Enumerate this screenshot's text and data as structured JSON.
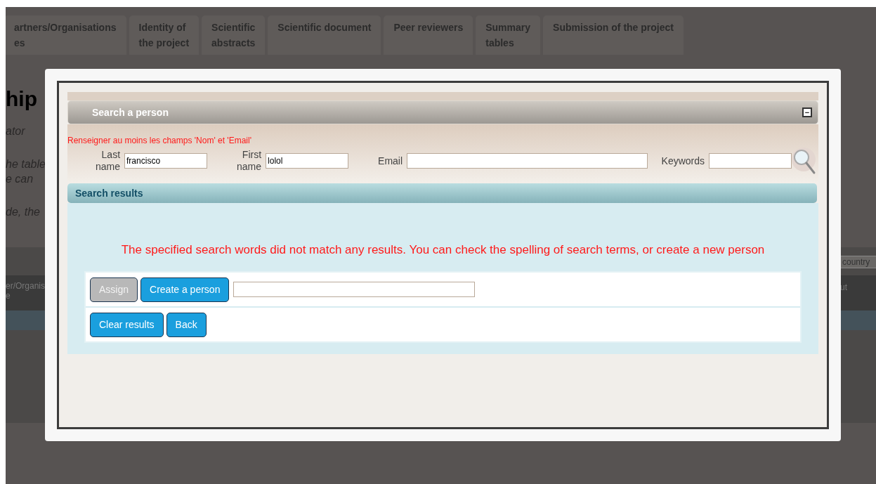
{
  "background": {
    "tabs": [
      {
        "label": "artners/Organisations\nes",
        "selected": false
      },
      {
        "label": "Identity of\nthe project",
        "selected": false
      },
      {
        "label": "Scientific\nabstracts",
        "selected": false
      },
      {
        "label": "Scientific document",
        "selected": false
      },
      {
        "label": "Peer reviewers",
        "selected": false
      },
      {
        "label": "Summary\ntables",
        "selected": false
      },
      {
        "label": "Submission of the project",
        "selected": false
      }
    ],
    "heading": "hip",
    "paragraphs": [
      "ator",
      "he table\ne can",
      "de, the"
    ],
    "table": {
      "filter_placeholder": "country",
      "column_1": "er/Organis\ne",
      "column_last": "ut"
    }
  },
  "dialog": {
    "panel_title": "Search a person",
    "collapse_icon": "−",
    "instruction": "Renseigner au moins les champs 'Nom' et 'Email'",
    "fields": [
      {
        "label": "Last\nname",
        "value": "francisco",
        "kind": "short"
      },
      {
        "label": "First\nname",
        "value": "lolol",
        "kind": "short"
      },
      {
        "label": "Email",
        "kind": "wide"
      },
      {
        "label": "Keywords",
        "kind": "short"
      }
    ],
    "results_title": "Search results",
    "message": "The specified search words did not match any results. You can check the spelling of search terms, or create a new person",
    "rows": [
      {
        "buttons": [
          {
            "label": "Assign",
            "disabled": true
          },
          {
            "label": "Create a person",
            "disabled": false
          }
        ],
        "has_field": true
      },
      {
        "buttons": [
          {
            "label": "Clear results",
            "disabled": false
          },
          {
            "label": "Back",
            "disabled": false
          }
        ],
        "has_field": false
      }
    ]
  }
}
